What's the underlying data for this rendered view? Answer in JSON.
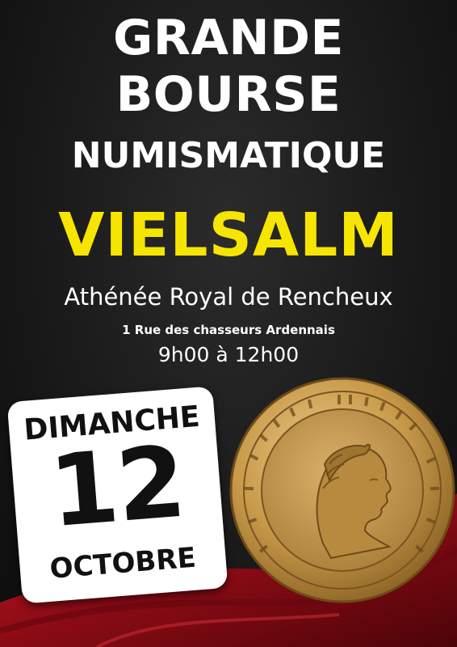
{
  "title_line1": "GRANDE",
  "title_line2": "BOURSE",
  "title_line3": "NUMISMATIQUE",
  "city": "VIELSALM",
  "venue": "Athénée Royal de Rencheux",
  "address": "1 Rue des chasseurs Ardennais",
  "hours": "9h00 à 12h00",
  "date": {
    "weekday": "DIMANCHE",
    "day": "12",
    "month": "OCTOBRE"
  },
  "colors": {
    "background": "#1a1a1a",
    "accent_yellow": "#f6e500",
    "drape_red": "#a4101a",
    "coin_gold": "#c89a4a"
  }
}
